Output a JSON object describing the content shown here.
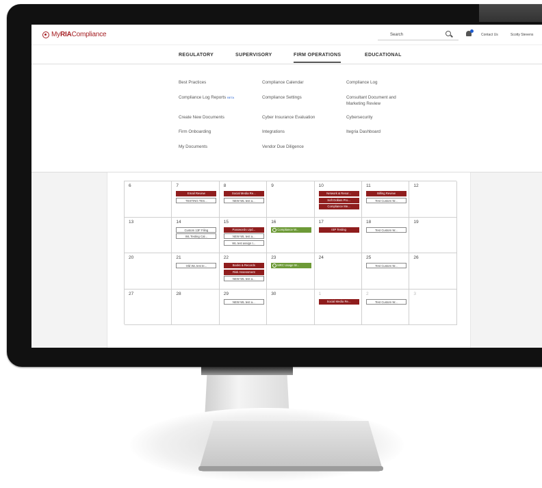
{
  "brand": {
    "name_pre": "My",
    "name_ria": "RIA",
    "name_post": "Compliance",
    "color": "#a41e22"
  },
  "header": {
    "search_label": "Search",
    "contact": "Contact Us",
    "user": "Scotty Stevens"
  },
  "nav": {
    "items": [
      "REGULATORY",
      "SUPERVISORY",
      "FIRM OPERATIONS",
      "EDUCATIONAL"
    ],
    "active": "FIRM OPERATIONS"
  },
  "menu": {
    "col1": [
      "Best Practices",
      "Compliance Log Reports",
      "Create New Documents",
      "Firm Onboarding",
      "My Documents"
    ],
    "col1_badge": "BETA",
    "col2": [
      "Compliance Calendar",
      "Compliance Settings",
      "Cyber Insurance Evaluation",
      "Integrations",
      "Vendor Due Diligence"
    ],
    "col3": [
      "Compliance Log",
      "Consultant Document and Marketing Review",
      "Cybersecurity",
      "Itegria Dashboard"
    ]
  },
  "calendar": {
    "weeks": [
      [
        {
          "day": "6",
          "events": []
        },
        {
          "day": "7",
          "events": [
            {
              "label": "Email Review",
              "style": "red"
            },
            {
              "label": "TESTING TES...",
              "style": "outline"
            }
          ]
        },
        {
          "day": "8",
          "events": [
            {
              "label": "Social Media Re...",
              "style": "red"
            },
            {
              "label": "NEW WL test a...",
              "style": "outline"
            }
          ]
        },
        {
          "day": "9",
          "events": []
        },
        {
          "day": "10",
          "events": [
            {
              "label": "Network & Resor...",
              "style": "red"
            },
            {
              "label": "Soft Dollars Pro...",
              "style": "red"
            },
            {
              "label": "Compliance Me...",
              "style": "red"
            }
          ]
        },
        {
          "day": "11",
          "events": [
            {
              "label": "Billing Review",
              "style": "red"
            },
            {
              "label": "Test Custom W...",
              "style": "outline"
            }
          ]
        },
        {
          "day": "12",
          "events": []
        }
      ],
      [
        {
          "day": "13",
          "events": []
        },
        {
          "day": "14",
          "events": [
            {
              "label": "Custom 13F Filing",
              "style": "outline"
            },
            {
              "label": "WL Testing Cal...",
              "style": "outline"
            }
          ]
        },
        {
          "day": "15",
          "events": [
            {
              "label": "Passwords Upd...",
              "style": "red"
            },
            {
              "label": "NEW WL test a...",
              "style": "outline"
            },
            {
              "label": "WL test assign t...",
              "style": "outline"
            }
          ]
        },
        {
          "day": "16",
          "events": [
            {
              "label": "Compliance W...",
              "style": "green"
            }
          ]
        },
        {
          "day": "17",
          "events": [
            {
              "label": "ISP Testing",
              "style": "red"
            }
          ]
        },
        {
          "day": "18",
          "events": [
            {
              "label": "Test Custom W...",
              "style": "outline"
            }
          ]
        },
        {
          "day": "19",
          "events": []
        }
      ],
      [
        {
          "day": "20",
          "events": []
        },
        {
          "day": "21",
          "events": [
            {
              "label": "Old WL test te...",
              "style": "outline"
            }
          ]
        },
        {
          "day": "22",
          "events": [
            {
              "label": "Books & Records",
              "style": "red"
            },
            {
              "label": "Risk Assessment",
              "style": "red"
            },
            {
              "label": "NEW WL test a...",
              "style": "outline"
            }
          ]
        },
        {
          "day": "23",
          "events": [
            {
              "label": "MRC Usage W...",
              "style": "green"
            }
          ]
        },
        {
          "day": "24",
          "events": []
        },
        {
          "day": "25",
          "events": [
            {
              "label": "Test Custom W...",
              "style": "outline"
            }
          ]
        },
        {
          "day": "26",
          "events": []
        }
      ],
      [
        {
          "day": "27",
          "events": []
        },
        {
          "day": "28",
          "events": []
        },
        {
          "day": "29",
          "events": [
            {
              "label": "NEW WL test a...",
              "style": "outline"
            }
          ]
        },
        {
          "day": "30",
          "events": []
        },
        {
          "day": "1",
          "muted": true,
          "events": [
            {
              "label": "Social Media Re...",
              "style": "red"
            }
          ]
        },
        {
          "day": "2",
          "muted": true,
          "events": [
            {
              "label": "Test Custom W...",
              "style": "outline"
            }
          ]
        },
        {
          "day": "3",
          "muted": true,
          "events": []
        }
      ]
    ]
  },
  "colors": {
    "event_red": "#8f1d1d",
    "event_green": "#6d9a37",
    "accent_blue": "#1e5ccf"
  }
}
